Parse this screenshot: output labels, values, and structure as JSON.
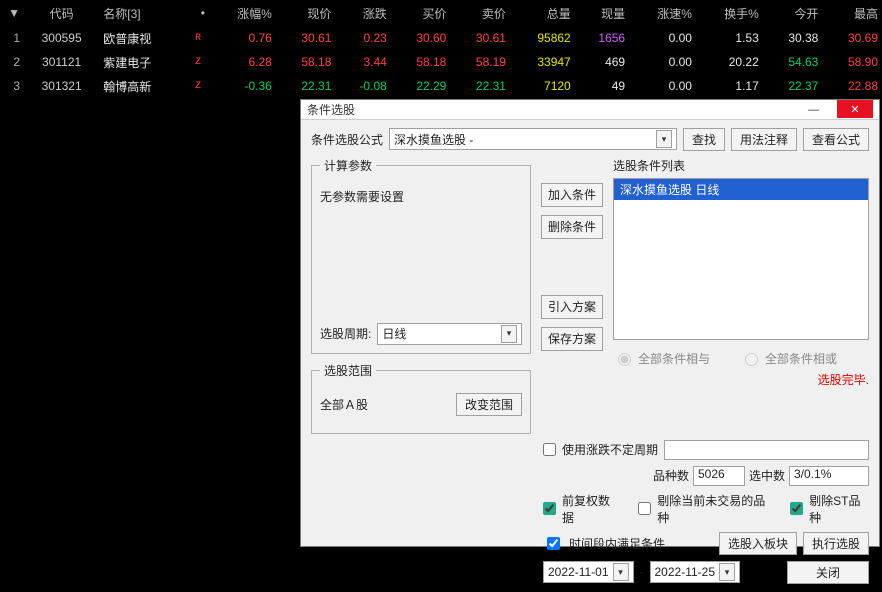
{
  "table": {
    "headers": [
      "代码",
      "名称[3]",
      "涨幅%",
      "现价",
      "涨跌",
      "买价",
      "卖价",
      "总量",
      "现量",
      "涨速%",
      "换手%",
      "今开",
      "最高"
    ],
    "rows": [
      {
        "idx": "1",
        "code": "300595",
        "name": "欧普康视",
        "flag": "R",
        "pct": "0.76",
        "price": "30.61",
        "chg": "0.23",
        "bid": "30.60",
        "ask": "30.61",
        "vol": "95862",
        "now": "1656",
        "speed": "0.00",
        "turn": "1.53",
        "open": "30.38",
        "high": "30.69",
        "cls": {
          "pct": "up",
          "price": "up",
          "chg": "up",
          "bid": "up",
          "ask": "up",
          "vol": "vol",
          "now": "cash",
          "speed": "white",
          "turn": "white",
          "open": "white",
          "high": "up"
        }
      },
      {
        "idx": "2",
        "code": "301121",
        "name": "紫建电子",
        "flag": "Z",
        "pct": "6.28",
        "price": "58.18",
        "chg": "3.44",
        "bid": "58.18",
        "ask": "58.19",
        "vol": "33947",
        "now": "469",
        "speed": "0.00",
        "turn": "20.22",
        "open": "54.63",
        "high": "58.90",
        "cls": {
          "pct": "up",
          "price": "up",
          "chg": "up",
          "bid": "up",
          "ask": "up",
          "vol": "vol",
          "now": "white",
          "speed": "white",
          "turn": "white",
          "open": "down",
          "high": "up"
        }
      },
      {
        "idx": "3",
        "code": "301321",
        "name": "翰博高新",
        "flag": "Z",
        "pct": "-0.36",
        "price": "22.31",
        "chg": "-0.08",
        "bid": "22.29",
        "ask": "22.31",
        "vol": "7120",
        "now": "49",
        "speed": "0.00",
        "turn": "1.17",
        "open": "22.37",
        "high": "22.88",
        "cls": {
          "pct": "down",
          "price": "down",
          "chg": "down",
          "bid": "down",
          "ask": "down",
          "vol": "vol",
          "now": "white",
          "speed": "white",
          "turn": "white",
          "open": "down",
          "high": "up"
        }
      }
    ]
  },
  "dialog": {
    "title": "条件选股",
    "formula_label": "条件选股公式",
    "formula_value": "深水摸鱼选股 -",
    "btn_find": "查找",
    "btn_usage": "用法注释",
    "btn_viewformula": "查看公式",
    "calc_params_title": "计算参数",
    "no_params_text": "无参数需要设置",
    "period_label": "选股周期:",
    "period_value": "日线",
    "range_title": "选股范围",
    "range_value": "全部Ａ股",
    "btn_change_range": "改变范围",
    "btn_add": "加入条件",
    "btn_del": "删除条件",
    "btn_import": "引入方案",
    "btn_save": "保存方案",
    "list_title": "选股条件列表",
    "list_item": "深水摸鱼选股  日线",
    "radio_and": "全部条件相与",
    "radio_or": "全部条件相或",
    "status_done": "选股完毕.",
    "chk_use_uncertain": "使用涨跌不定周期",
    "kinds_label": "品种数",
    "kinds_value": "5026",
    "selected_label": "选中数",
    "selected_value": "3/0.1%",
    "chk_fq": "前复权数据",
    "chk_excl_notrade": "剔除当前未交易的品种",
    "chk_excl_st": "剔除ST品种",
    "chk_timerange": "时间段内满足条件",
    "btn_toblock": "选股入板块",
    "btn_run": "执行选股",
    "date_from": "2022-11-01",
    "date_to": "2022-11-25",
    "btn_close": "关闭"
  }
}
